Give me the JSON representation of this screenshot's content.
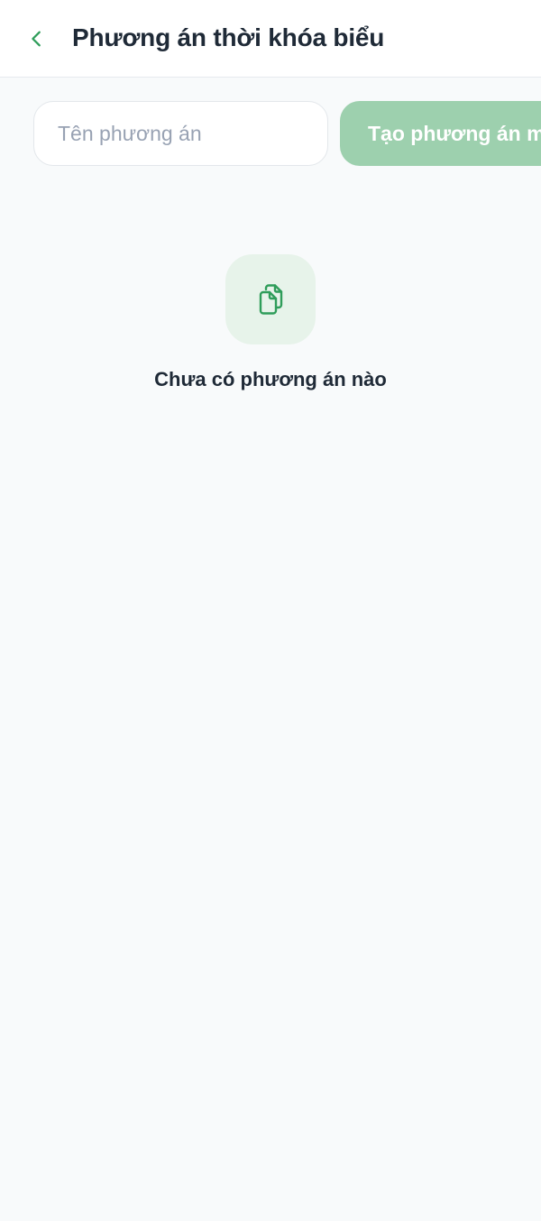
{
  "header": {
    "title": "Phương án thời khóa biểu",
    "back_icon": "chevron-left-icon"
  },
  "form": {
    "name_placeholder": "Tên phương án",
    "name_value": "",
    "create_button_label": "Tạo phương án mới"
  },
  "empty_state": {
    "icon": "documents-icon",
    "message": "Chưa có phương án nào"
  },
  "colors": {
    "accent": "#2f9d5a",
    "button_disabled": "#9dd0ae",
    "icon_bg": "#e7f3ea",
    "page_bg": "#f8fafb"
  }
}
